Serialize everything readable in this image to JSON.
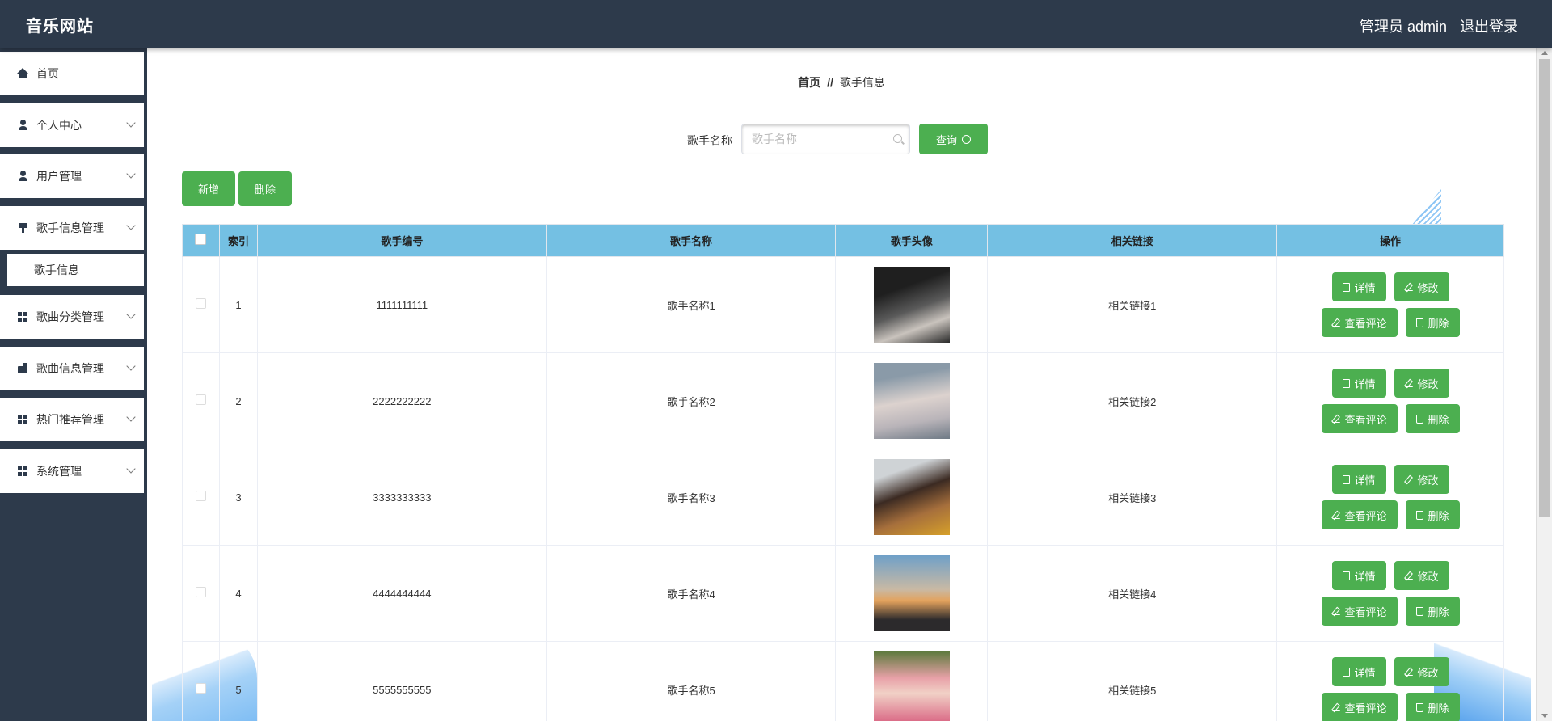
{
  "header": {
    "brand": "音乐网站",
    "user": "管理员 admin",
    "logout": "退出登录"
  },
  "sidebar": {
    "items": [
      {
        "label": "首页",
        "icon": "home-icon"
      },
      {
        "label": "个人中心",
        "icon": "user-icon"
      },
      {
        "label": "用户管理",
        "icon": "user-icon"
      },
      {
        "label": "歌手信息管理",
        "icon": "mic-icon"
      },
      {
        "label": "歌曲分类管理",
        "icon": "grid-icon"
      },
      {
        "label": "歌曲信息管理",
        "icon": "wallet-icon"
      },
      {
        "label": "热门推荐管理",
        "icon": "grid-icon"
      },
      {
        "label": "系统管理",
        "icon": "grid-icon"
      }
    ],
    "submenu": {
      "label": "歌手信息"
    }
  },
  "breadcrumb": {
    "home": "首页",
    "sep": "//",
    "current": "歌手信息"
  },
  "search": {
    "label": "歌手名称",
    "placeholder": "歌手名称",
    "query": "查询"
  },
  "toolbar": {
    "add": "新增",
    "delete": "删除"
  },
  "table": {
    "headers": [
      "索引",
      "歌手编号",
      "歌手名称",
      "歌手头像",
      "相关链接",
      "操作"
    ],
    "rows": [
      {
        "index": "1",
        "code": "1111111111",
        "name": "歌手名称1",
        "link": "相关链接1"
      },
      {
        "index": "2",
        "code": "2222222222",
        "name": "歌手名称2",
        "link": "相关链接2"
      },
      {
        "index": "3",
        "code": "3333333333",
        "name": "歌手名称3",
        "link": "相关链接3"
      },
      {
        "index": "4",
        "code": "4444444444",
        "name": "歌手名称4",
        "link": "相关链接4"
      },
      {
        "index": "5",
        "code": "5555555555",
        "name": "歌手名称5",
        "link": "相关链接5"
      }
    ],
    "actions": {
      "detail": "详情",
      "edit": "修改",
      "comments": "查看评论",
      "delete": "删除"
    }
  },
  "colors": {
    "topbar": "#2d3a4b",
    "accent": "#4caf50",
    "table_header": "#74c0e3"
  }
}
